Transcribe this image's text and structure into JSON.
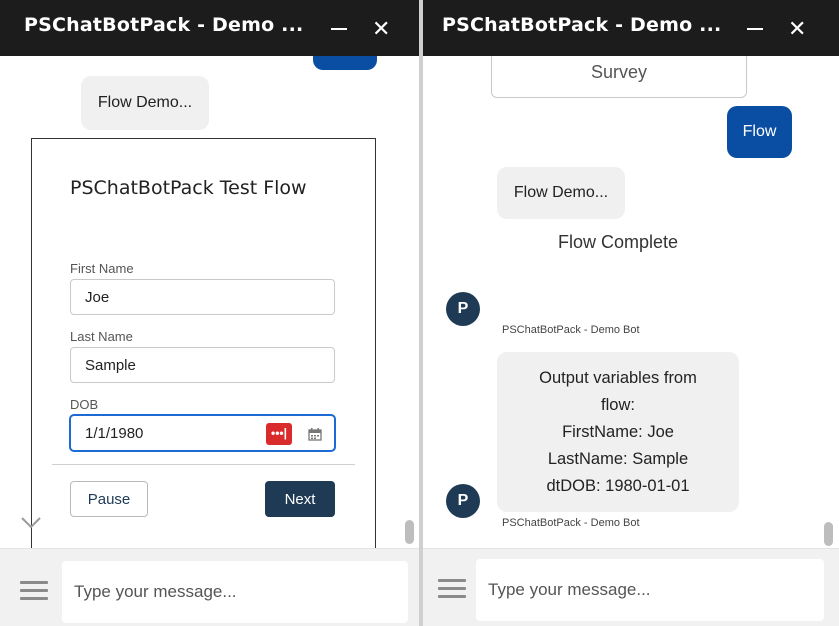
{
  "window_left": {
    "title": "PSChatBotPack - Demo ...",
    "bot_bubble": "Flow Demo...",
    "flow_card": {
      "heading": "PSChatBotPack Test Flow",
      "first_name_label": "First Name",
      "first_name_value": "Joe",
      "last_name_label": "Last Name",
      "last_name_value": "Sample",
      "dob_label": "DOB",
      "dob_value": "1/1/1980",
      "pause_label": "Pause",
      "next_label": "Next"
    },
    "input_placeholder": "Type your message..."
  },
  "window_right": {
    "title": "PSChatBotPack - Demo ...",
    "survey_option": "Survey",
    "user_message": "Flow",
    "bot_bubble": "Flow Demo...",
    "flow_complete": "Flow Complete",
    "avatar_letter": "P",
    "bot_name": "PSChatBotPack - Demo Bot",
    "output_lines": [
      "Output variables from",
      "flow:",
      "FirstName: Joe",
      "LastName: Sample",
      "dtDOB: 1980-01-01"
    ],
    "input_placeholder": "Type your message..."
  },
  "colors": {
    "titlebar": "#1c1c1c",
    "user_bubble": "#0a4ea3",
    "avatar": "#1e3a55",
    "next_button": "#1e3a55",
    "focus_ring": "#1b6ad6",
    "password_manager_icon": "#d92b2b"
  },
  "icons": [
    "minimize-icon",
    "close-icon",
    "chevron-down-icon",
    "calendar-icon",
    "password-manager-icon",
    "menu-icon"
  ]
}
